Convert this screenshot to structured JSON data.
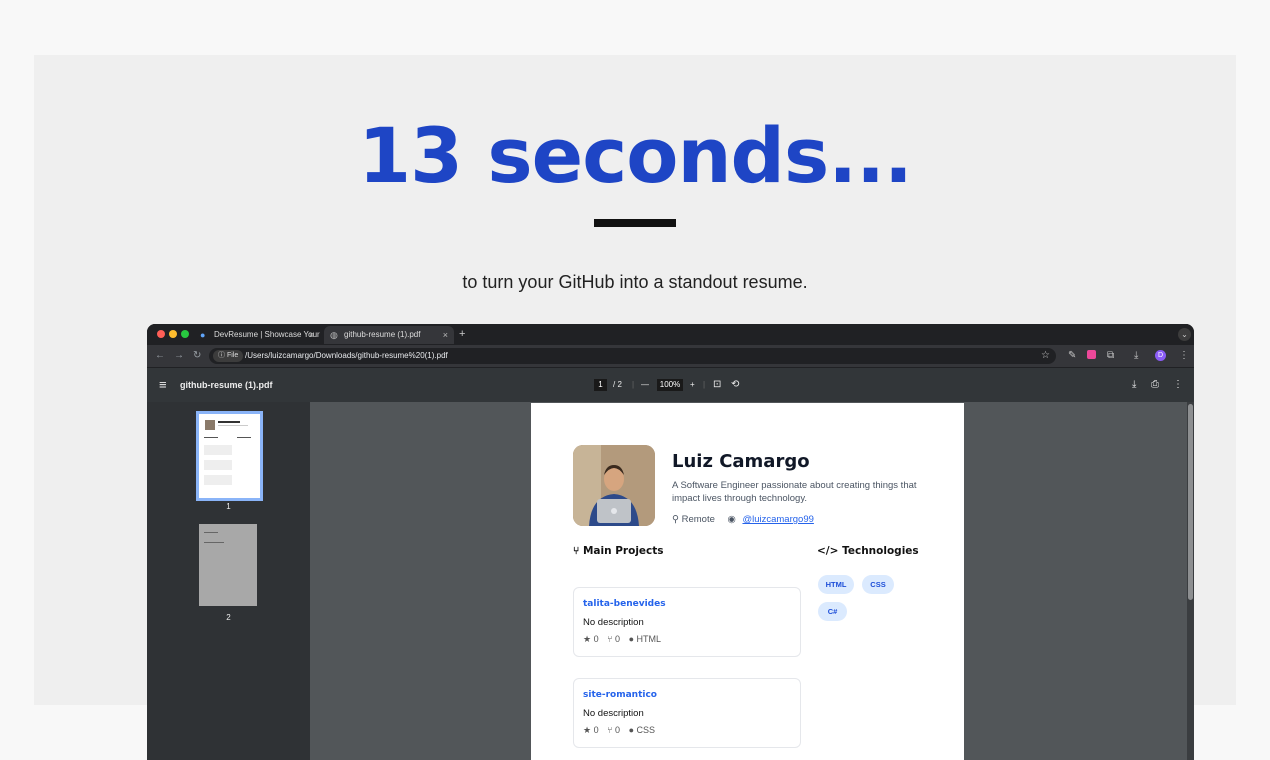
{
  "headline": "13 seconds...",
  "subtitle": "to turn your GitHub into a standout resume.",
  "browser": {
    "tabs": [
      {
        "title": "DevResume | Showcase Your",
        "close": "×",
        "active": false
      },
      {
        "title": "github-resume (1).pdf",
        "close": "×",
        "active": true
      }
    ],
    "new_tab": "+",
    "address": {
      "chip": "ⓘ File",
      "url": "/Users/luizcamargo/Downloads/github-resume%20(1).pdf"
    },
    "profile_initial": "D"
  },
  "pdf_toolbar": {
    "filename": "github-resume (1).pdf",
    "current_page": "1",
    "total_pages": "/ 2",
    "zoom": "100%",
    "zoom_out": "—",
    "zoom_in": "+"
  },
  "thumbnails": [
    {
      "page_number": "1",
      "selected": true
    },
    {
      "page_number": "2",
      "selected": false
    }
  ],
  "resume": {
    "name": "Luiz Camargo",
    "bio": "A Software Engineer passionate about creating things that impact lives through technology.",
    "location": "Remote",
    "github_handle": "@luizcamargo99",
    "projects_heading": "Main Projects",
    "technologies_heading": "Technologies",
    "projects": [
      {
        "name": "talita-benevides",
        "description": "No description",
        "stars": "0",
        "forks": "0",
        "language": "HTML"
      },
      {
        "name": "site-romantico",
        "description": "No description",
        "stars": "0",
        "forks": "0",
        "language": "CSS"
      }
    ],
    "technologies": [
      "HTML",
      "CSS",
      "C#"
    ]
  },
  "colors": {
    "headline_blue": "#1e45c5",
    "link_blue": "#2563eb",
    "tag_bg": "#dbeafe",
    "browser_dark": "#202124",
    "viewer_gray": "#525659"
  }
}
